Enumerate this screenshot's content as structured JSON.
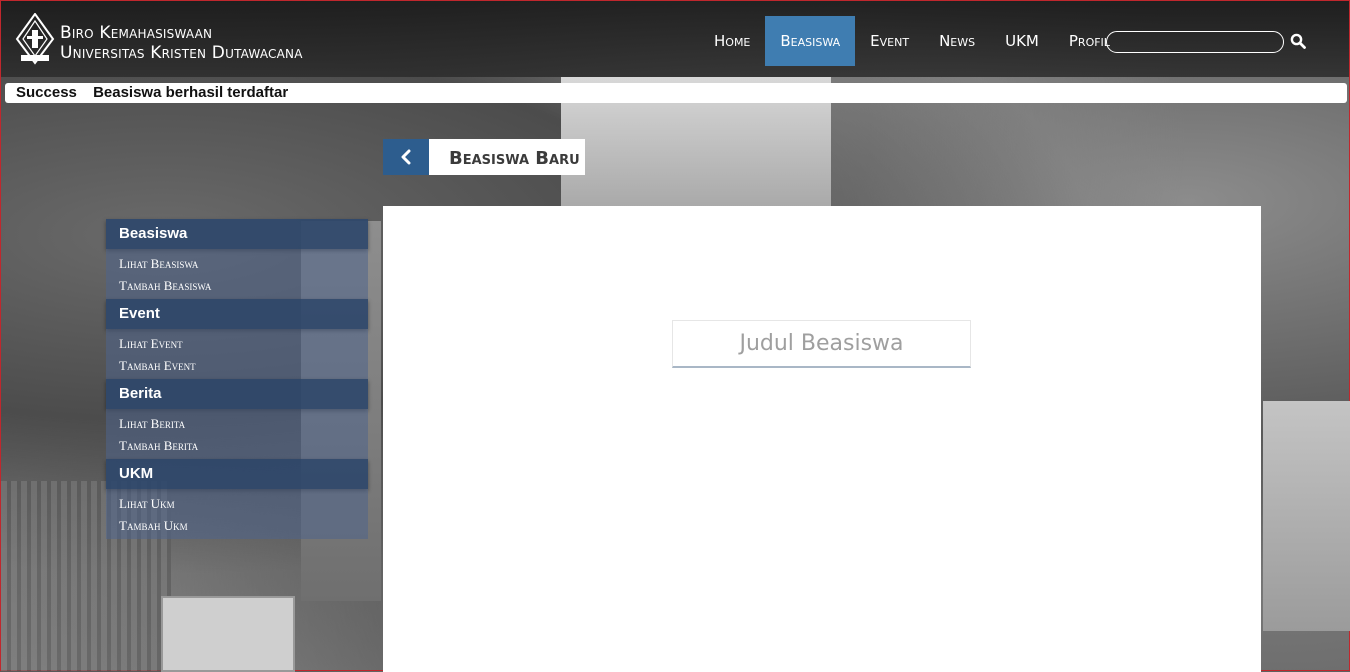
{
  "brand": {
    "line1": "Biro Kemahasiswaan",
    "line2": "Universitas Kristen Dutawacana"
  },
  "nav": {
    "items": [
      {
        "label": "Home",
        "active": false
      },
      {
        "label": "Beasiswa",
        "active": true
      },
      {
        "label": "Event",
        "active": false
      },
      {
        "label": "News",
        "active": false
      },
      {
        "label": "UKM",
        "active": false
      },
      {
        "label": "Profil",
        "active": false
      }
    ],
    "search": {
      "placeholder": "",
      "value": ""
    }
  },
  "alert": {
    "title": "Success",
    "message": "Beasiswa berhasil terdaftar"
  },
  "page": {
    "title": "Beasiswa Baru"
  },
  "sidebar": {
    "sections": [
      {
        "heading": "Beasiswa",
        "items": [
          "Lihat Beasiswa",
          "Tambah Beasiswa"
        ]
      },
      {
        "heading": "Event",
        "items": [
          "Lihat Event",
          "Tambah Event"
        ]
      },
      {
        "heading": "Berita",
        "items": [
          "Lihat Berita",
          "Tambah Berita"
        ]
      },
      {
        "heading": "UKM",
        "items": [
          "Lihat Ukm",
          "Tambah Ukm"
        ]
      }
    ]
  },
  "form": {
    "judul_placeholder": "Judul Beasiswa",
    "judul_value": ""
  },
  "colors": {
    "accent": "#3f7db1",
    "sidebar_heading": "#2f486b",
    "back_button": "#2d5d8e"
  }
}
